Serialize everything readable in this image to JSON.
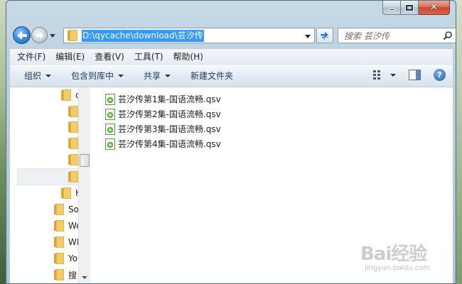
{
  "window": {
    "title": "",
    "caption_buttons": [
      "minimize",
      "maximize",
      "close"
    ]
  },
  "navigation": {
    "address_path": "D:\\qycache\\download\\芸汐传",
    "search_placeholder": "搜索 芸汐传"
  },
  "menubar": {
    "items": [
      {
        "label": "文件(F)"
      },
      {
        "label": "编辑(E)"
      },
      {
        "label": "查看(V)"
      },
      {
        "label": "工具(T)"
      },
      {
        "label": "帮助(H)"
      }
    ]
  },
  "commandbar": {
    "organize": "组织",
    "include_in_library": "包含到库中",
    "share": "共享",
    "new_folder": "新建文件夹"
  },
  "nav_pane": {
    "items": [
      {
        "label": "c",
        "indent": 2
      },
      {
        "label": "",
        "indent": 3
      },
      {
        "label": "",
        "indent": 3
      },
      {
        "label": "",
        "indent": 3
      },
      {
        "label": "",
        "indent": 3
      },
      {
        "label": "",
        "indent": 3,
        "selected": true
      },
      {
        "label": "H",
        "indent": 2
      },
      {
        "label": "So",
        "indent": 1
      },
      {
        "label": "We",
        "indent": 1
      },
      {
        "label": "WI",
        "indent": 1
      },
      {
        "label": "Yo",
        "indent": 1
      },
      {
        "label": "搜",
        "indent": 1
      }
    ]
  },
  "files": [
    {
      "name": "芸汐传第1集-国语流畅.qsv",
      "icon": "qsv-file-icon"
    },
    {
      "name": "芸汐传第2集-国语流畅.qsv",
      "icon": "qsv-file-icon"
    },
    {
      "name": "芸汐传第3集-国语流畅.qsv",
      "icon": "qsv-file-icon"
    },
    {
      "name": "芸汐传第4集-国语流畅.qsv",
      "icon": "qsv-file-icon"
    }
  ],
  "watermark": {
    "logo": "Bai经验",
    "url": "jingyan.baidu.com"
  },
  "colors": {
    "selection_blue": "#3399ff",
    "folder_yellow": "#e8c25a",
    "file_green": "#5fb34a"
  }
}
